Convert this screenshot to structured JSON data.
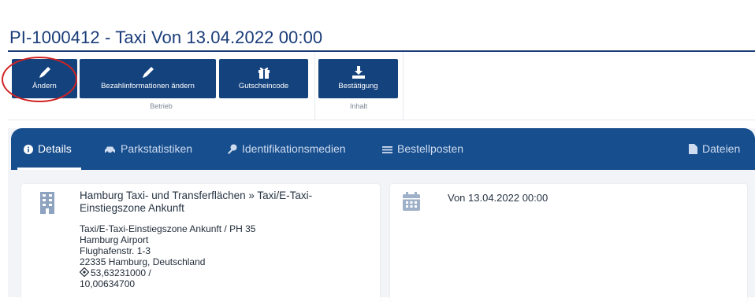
{
  "page": {
    "title": "PI-1000412 - Taxi Von 13.04.2022 00:00"
  },
  "toolbar": {
    "groups": [
      {
        "label": "Betrieb",
        "buttons": [
          {
            "label": "Ändern",
            "icon": "pencil-icon"
          },
          {
            "label": "Bezahlinformationen ändern",
            "icon": "pencil-icon"
          },
          {
            "label": "Gutscheincode",
            "icon": "gift-icon"
          }
        ]
      },
      {
        "label": "Inhalt",
        "buttons": [
          {
            "label": "Bestätigung",
            "icon": "download-icon"
          }
        ]
      }
    ]
  },
  "tabs": [
    {
      "label": "Details",
      "icon": "info-icon",
      "active": true
    },
    {
      "label": "Parkstatistiken",
      "icon": "car-icon"
    },
    {
      "label": "Identifikationsmedien",
      "icon": "key-icon"
    },
    {
      "label": "Bestellposten",
      "icon": "list-icon"
    },
    {
      "label": "Dateien",
      "icon": "file-icon"
    }
  ],
  "location_card": {
    "name": "Hamburg Taxi- und Transferflächen » Taxi/E-Taxi-Einstiegszone Ankunft",
    "lines": [
      "Taxi/E-Taxi-Einstiegszone Ankunft / PH 35",
      "Hamburg Airport",
      "Flughafenstr. 1-3",
      "22335 Hamburg, Deutschland",
      "53,63231000 /",
      "10,00634700"
    ]
  },
  "date_card": {
    "text": "Von 13.04.2022 00:00"
  },
  "colors": {
    "primary": "#14427d",
    "tabbar": "#174e8e",
    "title": "#1a3c78",
    "highlight_circle": "#d22222"
  }
}
